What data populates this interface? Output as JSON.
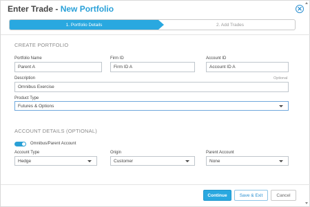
{
  "header": {
    "title_prefix": "Enter Trade - ",
    "title_accent": "New Portfolio",
    "close_glyph": "✕"
  },
  "stepper": {
    "step1": "1. Portfolio Details",
    "step2": "2. Add Trades"
  },
  "create_portfolio": {
    "section_title": "CREATE PORTFOLIO",
    "portfolio_name_label": "Portfolio Name",
    "portfolio_name_value": "Parent A",
    "firm_id_label": "Firm ID",
    "firm_id_value": "Firm ID A",
    "account_id_label": "Account ID",
    "account_id_value": "Account ID A",
    "description_label": "Description",
    "description_optional": "Optional",
    "description_value": "Omnibus Exercise",
    "product_type_label": "Product Type",
    "product_type_value": "Futures & Options"
  },
  "account_details": {
    "section_title": "ACCOUNT DETAILS (OPTIONAL)",
    "toggle_label": "Omnibus/Parent Account",
    "toggle_on": true,
    "account_type_label": "Account Type",
    "account_type_value": "Hedge",
    "origin_label": "Origin",
    "origin_value": "Customer",
    "parent_account_label": "Parent Account",
    "parent_account_value": "None"
  },
  "footer": {
    "continue": "Continue",
    "save_exit": "Save & Exit",
    "cancel": "Cancel"
  },
  "colors": {
    "accent": "#29a8e0",
    "title_accent": "#28a0d8"
  }
}
